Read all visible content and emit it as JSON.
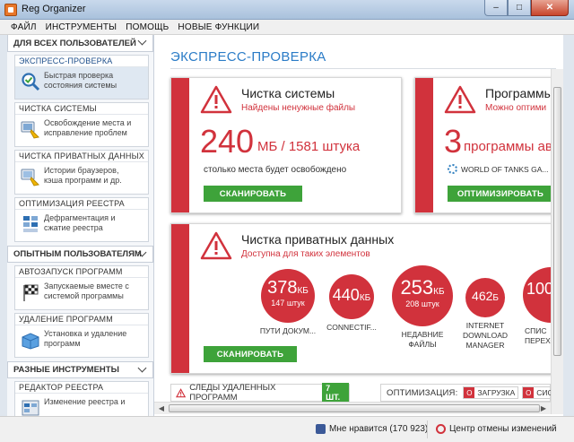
{
  "window": {
    "title": "Reg Organizer"
  },
  "menu": [
    "ФАЙЛ",
    "ИНСТРУМЕНТЫ",
    "ПОМОЩЬ",
    "НОВЫЕ ФУНКЦИИ"
  ],
  "sidebar": {
    "groups": [
      {
        "label": "ДЛЯ ВСЕХ ПОЛЬЗОВАТЕЛЕЙ",
        "items": [
          {
            "title": "ЭКСПРЕСС-ПРОВЕРКА",
            "desc1": "Быстрая проверка",
            "desc2": "состояния системы",
            "icon": "check-magnifier-icon",
            "active": true
          },
          {
            "title": "ЧИСТКА СИСТЕМЫ",
            "desc1": "Освобождение места и",
            "desc2": "исправление проблем",
            "icon": "broom-icon"
          },
          {
            "title": "ЧИСТКА ПРИВАТНЫХ ДАННЫХ",
            "desc1": "Истории браузеров,",
            "desc2": "кэша программ и др.",
            "icon": "privacy-broom-icon"
          },
          {
            "title": "ОПТИМИЗАЦИЯ РЕЕСТРА",
            "desc1": "Дефрагментация и",
            "desc2": "сжатие реестра",
            "icon": "registry-defrag-icon"
          }
        ]
      },
      {
        "label": "ОПЫТНЫМ ПОЛЬЗОВАТЕЛЯМ",
        "items": [
          {
            "title": "АВТОЗАПУСК ПРОГРАММ",
            "desc1": "Запускаемые вместе с",
            "desc2": "системой программы",
            "icon": "race-flag-icon"
          },
          {
            "title": "УДАЛЕНИЕ ПРОГРАММ",
            "desc1": "Установка и удаление",
            "desc2": "программ",
            "icon": "package-box-icon"
          }
        ]
      },
      {
        "label": "РАЗНЫЕ ИНСТРУМЕНТЫ",
        "items": [
          {
            "title": "РЕДАКТОР РЕЕСТРА",
            "desc1": "Изменение реестра и",
            "desc2": "",
            "icon": "registry-editor-icon"
          }
        ]
      }
    ]
  },
  "main": {
    "title": "ЭКСПРЕСС-ПРОВЕРКА",
    "cleanup": {
      "title": "Чистка системы",
      "subtitle": "Найдены ненужные файлы",
      "value": "240",
      "unit": "МБ / 1581 штука",
      "note": "столько места будет освобождено",
      "button": "СКАНИРОВАТЬ"
    },
    "programs": {
      "title": "Программы",
      "subtitle": "Можно оптими",
      "value": "3",
      "unit": "программы автоз",
      "item": "WORLD OF TANKS GA...",
      "button": "ОПТИМИЗИРОВАТЬ"
    },
    "privacy": {
      "title": "Чистка приватных данных",
      "subtitle": "Доступна для таких элементов",
      "button": "СКАНИРОВАТЬ",
      "items": [
        {
          "value": "378",
          "unit": "КБ",
          "count": "147 штук",
          "label1": "ПУТИ ДОКУМ...",
          "label2": "",
          "label3": ""
        },
        {
          "value": "440",
          "unit": "КБ",
          "count": "",
          "label1": "CONNECTIF...",
          "label2": "",
          "label3": ""
        },
        {
          "value": "253",
          "unit": "КБ",
          "count": "208 штук",
          "label1": "НЕДАВНИЕ",
          "label2": "ФАЙЛЫ",
          "label3": ""
        },
        {
          "value": "462",
          "unit": "Б",
          "count": "",
          "label1": "INTERNET",
          "label2": "DOWNLOAD",
          "label3": "MANAGER"
        },
        {
          "value": "100",
          "unit": "",
          "count": "",
          "label1": "СПИС",
          "label2": "ПЕРЕХО",
          "label3": ""
        }
      ]
    },
    "traces": {
      "label": "СЛЕДЫ УДАЛЕННЫХ ПРОГРАММ",
      "count": "7 ШТ."
    },
    "optimization": {
      "label": "ОПТИМИЗАЦИЯ:",
      "chips": [
        "ЗАГРУЗКА",
        "СИС"
      ]
    }
  },
  "status": {
    "like": "Мне нравится (170 923)",
    "undo": "Центр отмены изменений"
  },
  "colors": {
    "accent": "#d1323c",
    "title_blue": "#2b7cc7",
    "button_green": "#3ea33a"
  }
}
